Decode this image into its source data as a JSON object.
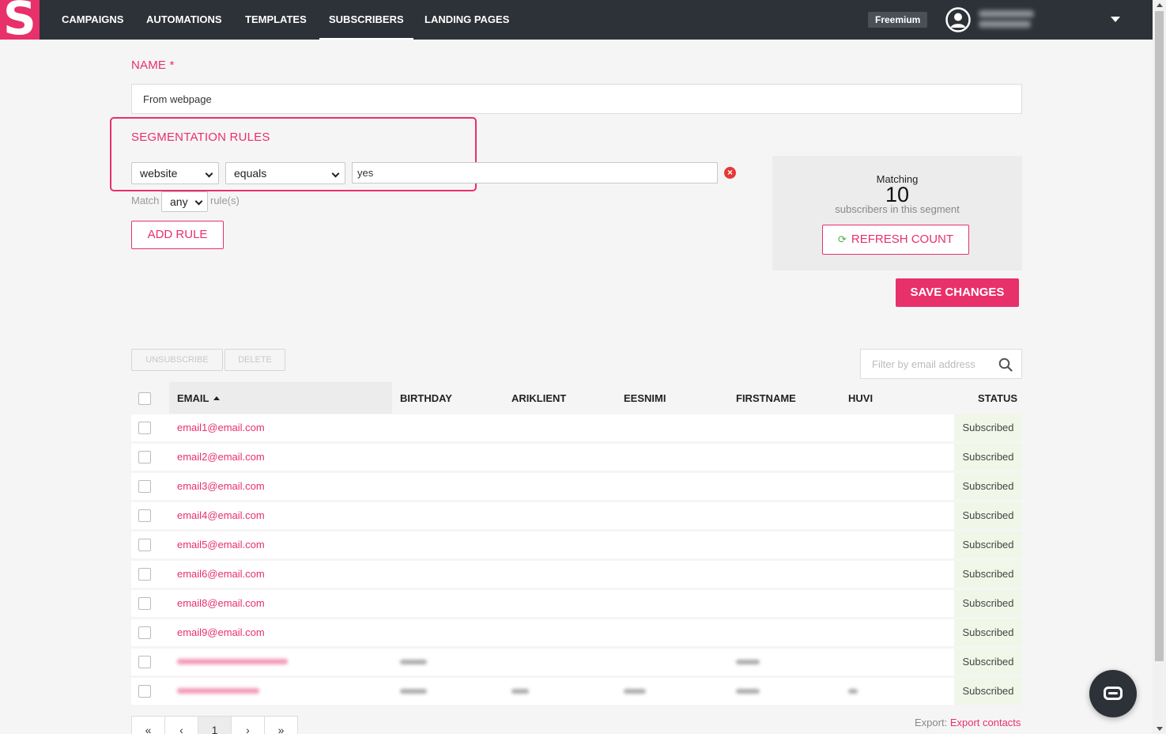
{
  "nav": {
    "logo": "S",
    "items": [
      "CAMPAIGNS",
      "AUTOMATIONS",
      "TEMPLATES",
      "SUBSCRIBERS",
      "LANDING PAGES"
    ],
    "active": "SUBSCRIBERS",
    "plan": "Freemium"
  },
  "form": {
    "name_label": "NAME *",
    "name_value": "From webpage",
    "segmentation_label": "SEGMENTATION RULES",
    "rule": {
      "field": "website",
      "operator": "equals",
      "value": "yes"
    },
    "match_prefix": "Match",
    "match_value": "any",
    "match_suffix": "rule(s)",
    "add_rule": "ADD RULE"
  },
  "matching": {
    "title": "Matching",
    "count": "10",
    "subtitle": "subscribers in this segment",
    "refresh": "REFRESH COUNT"
  },
  "save": "SAVE CHANGES",
  "bulk": {
    "unsubscribe": "UNSUBSCRIBE",
    "delete": "DELETE"
  },
  "filter": {
    "placeholder": "Filter by email address"
  },
  "table": {
    "columns": [
      "EMAIL",
      "BIRTHDAY",
      "ARIKLIENT",
      "EESNIMI",
      "FIRSTNAME",
      "HUVI",
      "STATUS"
    ],
    "rows": [
      {
        "email": "email1@email.com",
        "status": "Subscribed"
      },
      {
        "email": "email2@email.com",
        "status": "Subscribed"
      },
      {
        "email": "email3@email.com",
        "status": "Subscribed"
      },
      {
        "email": "email4@email.com",
        "status": "Subscribed"
      },
      {
        "email": "email5@email.com",
        "status": "Subscribed"
      },
      {
        "email": "email6@email.com",
        "status": "Subscribed"
      },
      {
        "email": "email8@email.com",
        "status": "Subscribed"
      },
      {
        "email": "email9@email.com",
        "status": "Subscribed"
      }
    ],
    "blurred_rows": [
      {
        "status": "Subscribed"
      },
      {
        "status": "Subscribed"
      }
    ]
  },
  "pagination": {
    "first": "«",
    "prev": "‹",
    "current": "1",
    "next": "›",
    "last": "»"
  },
  "export": {
    "prefix": "Export:",
    "link": "Export contacts"
  },
  "colors": {
    "accent": "#e8306b",
    "nav_bg": "#2d3238",
    "status_bg": "#f0f7e8"
  }
}
